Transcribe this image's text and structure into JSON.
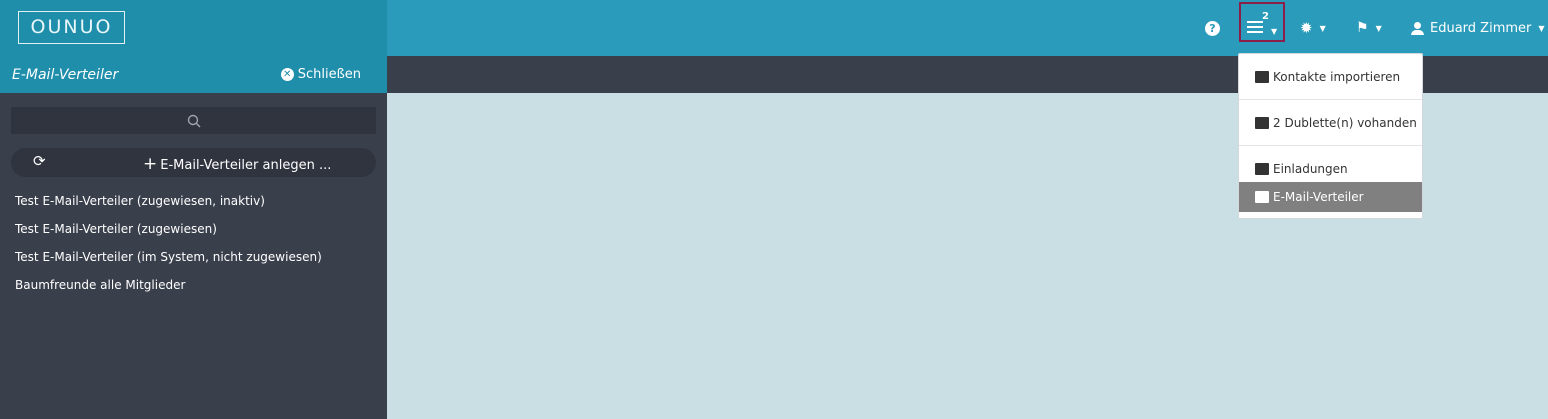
{
  "header": {
    "logo_text": "OUNUO",
    "help_label": "?",
    "notification_badge": "2",
    "user_name": "Eduard Zimmer"
  },
  "sidebar": {
    "title": "E-Mail-Verteiler",
    "close_label": "Schließen",
    "add_label": "E-Mail-Verteiler anlegen ...",
    "items": [
      {
        "label": "Test E-Mail-Verteiler (zugewiesen, inaktiv)"
      },
      {
        "label": "Test E-Mail-Verteiler (zugewiesen)"
      },
      {
        "label": "Test E-Mail-Verteiler (im System, nicht zugewiesen)"
      },
      {
        "label": "Baumfreunde alle Mitglieder"
      }
    ]
  },
  "dropdown": {
    "items": [
      {
        "label": "Kontakte importieren",
        "icon": "import-icon"
      },
      {
        "label": "2 Dublette(n) vohanden",
        "icon": "duplicate-icon"
      },
      {
        "label": "Einladungen",
        "icon": "invitations-icon"
      },
      {
        "label": "E-Mail-Verteiler",
        "icon": "mail-distribution-icon",
        "active": true
      }
    ]
  },
  "colors": {
    "topbar": "#2a9bba",
    "sidebar_header": "#1f8eab",
    "sidebar_bg": "#3a3f4c",
    "content_bg": "#c9dfe4",
    "highlight_border": "#8c1f4a",
    "active_item": "#808080"
  }
}
